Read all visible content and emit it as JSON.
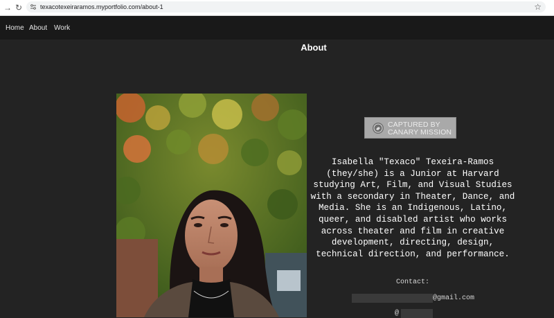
{
  "browser": {
    "url": "texacotexeiraramos.myportfolio.com/about-1"
  },
  "nav": {
    "home": "Home",
    "about": "About",
    "work": "Work"
  },
  "page": {
    "title": "About"
  },
  "stamp": {
    "line1": "CAPTURED BY",
    "line2": "CANARY MISSION"
  },
  "bio": {
    "lines": [
      "Isabella \"Texaco\" Texeira-Ramos",
      "(they/she) is a Junior at Harvard",
      "studying Art, Film, and Visual Studies",
      "with a secondary in Theater, Dance, and",
      "Media. She is an Indigenous, Latino,",
      "queer, and disabled artist who works",
      "across theater and film in creative",
      "development, directing, design,",
      "technical direction, and performance."
    ]
  },
  "contact": {
    "label": "Contact:",
    "email_suffix": "@gmail.com",
    "handle_prefix": "@"
  },
  "colors": {
    "page_bg": "#232323",
    "nav_bg": "#191919",
    "text": "#ffffff"
  }
}
